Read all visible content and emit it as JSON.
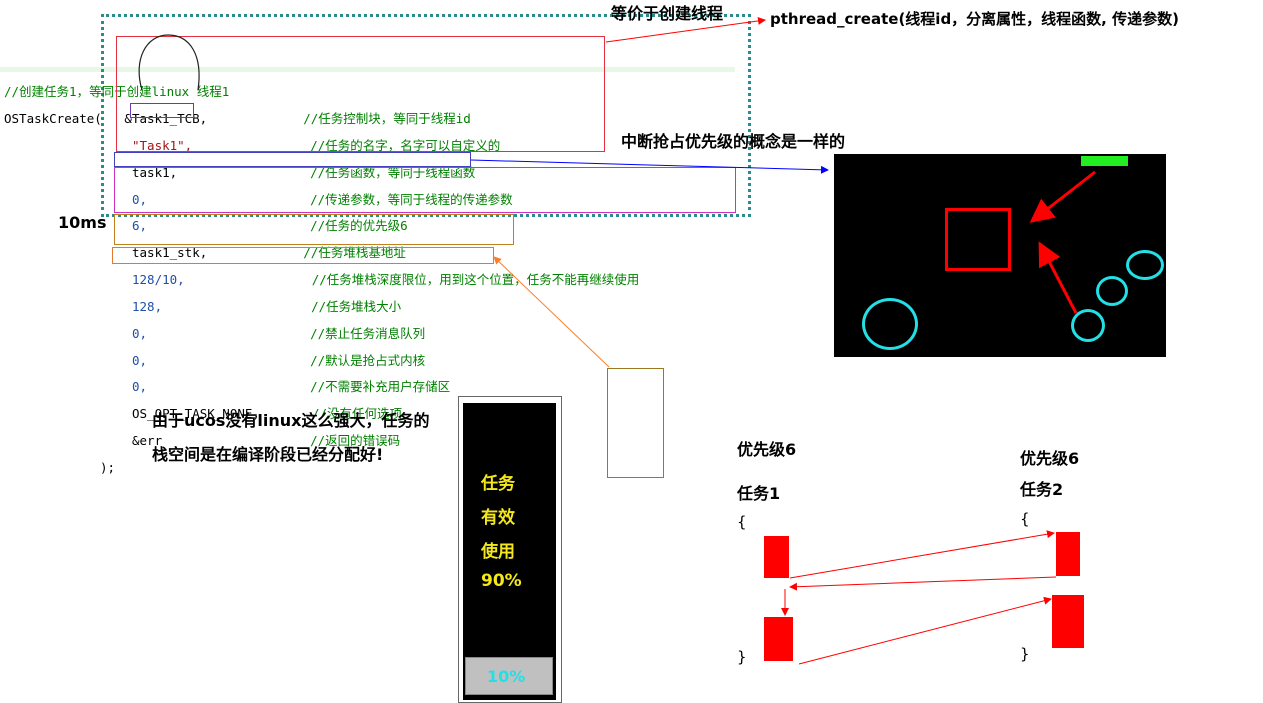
{
  "annotations": {
    "equiv_thread": "等价于创建线程",
    "pthread_sig": "pthread_create(线程id，分离属性，线程函数, 传递参数)",
    "interrupt_priority": "中断抢占优先级的概念是一样的",
    "ten_ms": "10ms",
    "stack_note": "由于ucos没有linux这么强大，任务的栈空间是在编译阶段已经分配好!"
  },
  "code": {
    "comment_header": "//创建任务1，等同于创建linux 线程1",
    "call_open": "OSTaskCreate(",
    "close": ");",
    "args": [
      {
        "arg": "&Task1_TCB,",
        "comment": "//任务控制块，等同于线程id"
      },
      {
        "arg": "\"Task1\",",
        "comment": "//任务的名字，名字可以自定义的"
      },
      {
        "arg": "task1,",
        "comment": "//任务函数，等同于线程函数"
      },
      {
        "arg": "0,",
        "comment": "//传递参数，等同于线程的传递参数"
      },
      {
        "arg": "6,",
        "comment": "//任务的优先级6"
      },
      {
        "arg": "task1_stk,",
        "comment": "//任务堆栈基地址"
      },
      {
        "arg": "128/10,",
        "comment": "//任务堆栈深度限位，用到这个位置，任务不能再继续使用"
      },
      {
        "arg": "128,",
        "comment": "//任务堆栈大小"
      },
      {
        "arg": "0,",
        "comment": "//禁止任务消息队列"
      },
      {
        "arg": "0,",
        "comment": "//默认是抢占式内核"
      },
      {
        "arg": "0,",
        "comment": "//不需要补充用户存储区"
      },
      {
        "arg": "OS_OPT_TASK_NONE,",
        "comment": "//没有任何选项"
      },
      {
        "arg": "&err",
        "comment": "//返回的错误码"
      }
    ]
  },
  "stack_bar": {
    "label_line1": "任务",
    "label_line2": "有效",
    "label_line3": "使用",
    "label_pct": "90%",
    "reserve_pct": "10%"
  },
  "tasks": {
    "left_priority": "优先级6",
    "left_name": "任务1",
    "right_priority": "优先级6",
    "right_name": "任务2",
    "brace_open": "{",
    "brace_close": "}"
  },
  "colors": {
    "code_comment": "#008000",
    "number": "#1f4fa8",
    "arrow_red": "#ff0000",
    "arrow_blue": "#0000ff",
    "arrow_orange": "#ff7f27",
    "accent_cyan": "#22e0e6",
    "accent_green": "#22ee22",
    "accent_yellow": "#f4e81a"
  }
}
